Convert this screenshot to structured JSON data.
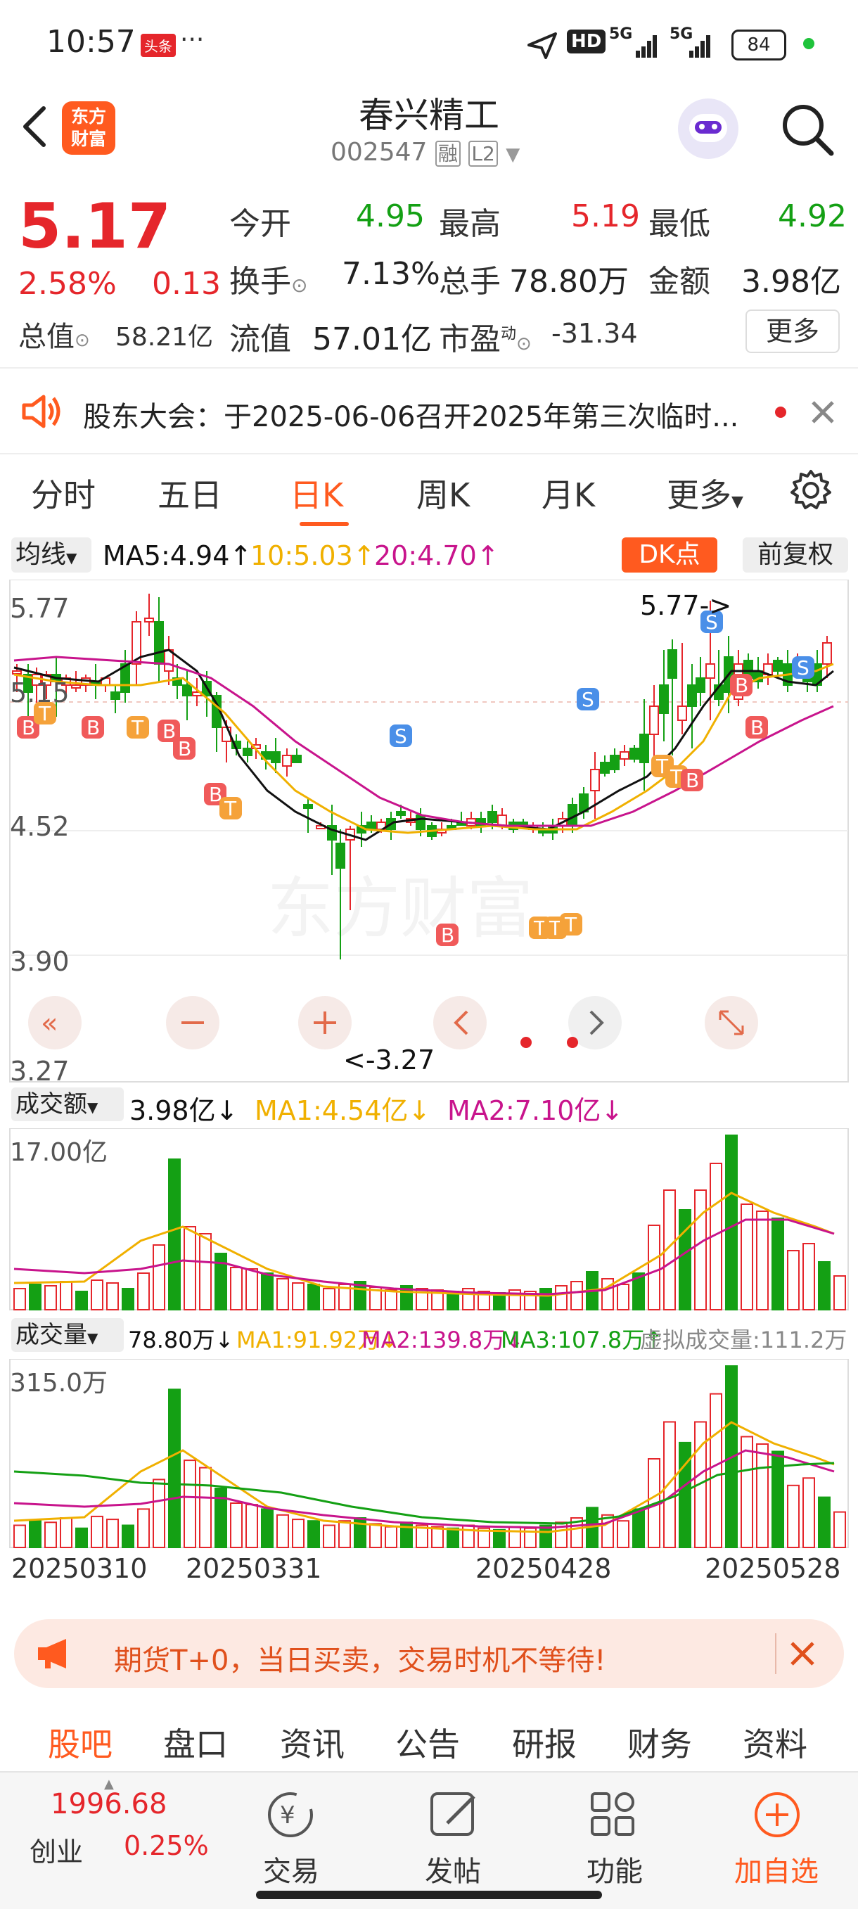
{
  "status_bar": {
    "time": "10:57",
    "badge": "头条",
    "dots": "···",
    "hd": "HD",
    "net1": "5G",
    "net2": "5G",
    "battery": "84"
  },
  "header": {
    "title": "春兴精工",
    "code": "002547",
    "tag_rong": "融",
    "tag_l2": "L2",
    "logo_line1": "东方",
    "logo_line2": "财富"
  },
  "quote": {
    "price": "5.17",
    "change_pct": "2.58%",
    "change": "0.13",
    "open_label": "今开",
    "open": "4.95",
    "high_label": "最高",
    "high": "5.19",
    "low_label": "最低",
    "low": "4.92",
    "turnover_label": "换手",
    "turnover": "7.13%",
    "volume_label": "总手",
    "volume": "78.80万",
    "amount_label": "金额",
    "amount": "3.98亿",
    "mktcap_label": "总值",
    "mktcap": "58.21亿",
    "float_label": "流值",
    "float": "57.01亿",
    "pe_label": "市盈",
    "pe_sup": "动",
    "pe": "-31.34",
    "more_label": "更多"
  },
  "notice": {
    "text": "股东大会：于2025-06-06召开2025年第三次临时..."
  },
  "tabs": [
    {
      "label": "分时"
    },
    {
      "label": "五日"
    },
    {
      "label": "日K"
    },
    {
      "label": "周K"
    },
    {
      "label": "月K"
    },
    {
      "label": "更多"
    }
  ],
  "ma_row": {
    "selector": "均线",
    "ma5": "MA5:4.94",
    "ma10": "10:5.03",
    "ma20": "20:4.70",
    "dk": "DK点",
    "fq": "前复权"
  },
  "kline": {
    "y_labels": [
      "5.77",
      "5.15",
      "4.52",
      "3.90",
      "3.27"
    ],
    "max_label": "5.77->",
    "min_label": "<-3.27"
  },
  "amount_row": {
    "selector": "成交额",
    "value": "3.98亿",
    "ma1": "MA1:4.54亿",
    "ma2": "MA2:7.10亿",
    "ymax": "17.00亿"
  },
  "volume_row": {
    "selector": "成交量",
    "value": "78.80万",
    "ma1": "MA1:91.92万",
    "ma2": "MA2:139.8万",
    "ma3": "MA3:107.8万",
    "virtual": "虚拟成交量:111.2万",
    "ymax": "315.0万"
  },
  "x_dates": [
    "20250310",
    "20250331",
    "20250428",
    "20250528"
  ],
  "promo": {
    "text": "期货T+0，当日买卖，交易时机不等待!"
  },
  "bottom_tabs": [
    {
      "label": "股吧"
    },
    {
      "label": "盘口"
    },
    {
      "label": "资讯"
    },
    {
      "label": "公告"
    },
    {
      "label": "研报"
    },
    {
      "label": "财务"
    },
    {
      "label": "资料"
    }
  ],
  "footer": {
    "index_value": "1996.68",
    "index_name": "创业",
    "index_pct": "0.25%",
    "trade": "交易",
    "post": "发帖",
    "func": "功能",
    "watch": "加自选"
  },
  "colors": {
    "up": "#e5262b",
    "down": "#14a014",
    "ma5": "#111111",
    "ma10": "#f0b000",
    "ma20": "#c8148c",
    "accent": "#ff5a1f"
  }
}
